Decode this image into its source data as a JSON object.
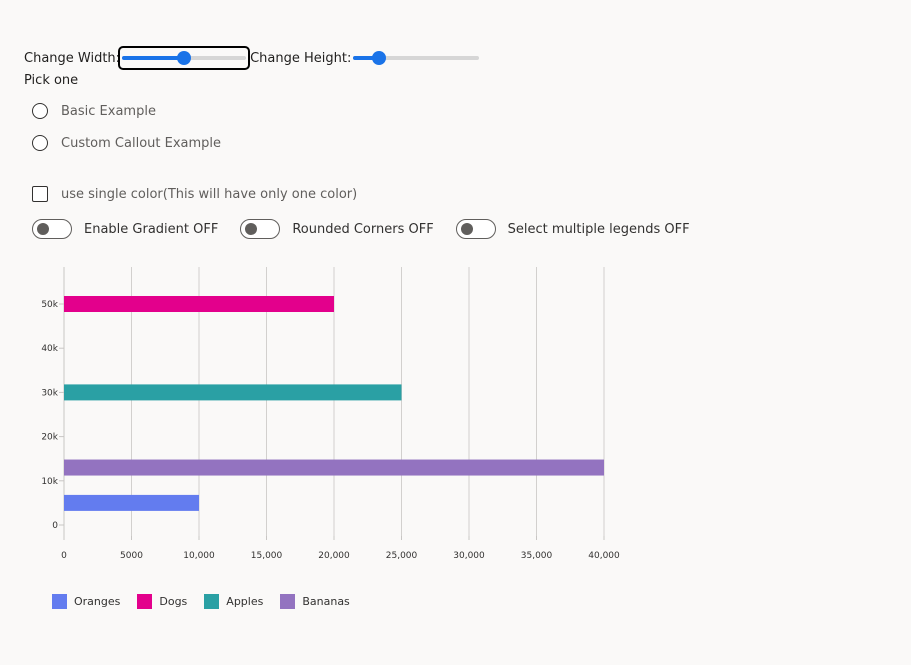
{
  "controls": {
    "width_label": "Change Width:",
    "height_label": "Change Height:",
    "width_slider_fraction": 0.5,
    "height_slider_fraction": 0.2,
    "pick_label": "Pick one",
    "radio_basic": "Basic Example",
    "radio_custom": "Custom Callout Example",
    "checkbox_label": "use single color(This will have only one color)",
    "toggle_gradient": "Enable Gradient OFF",
    "toggle_rounded": "Rounded Corners OFF",
    "toggle_legends": "Select multiple legends OFF"
  },
  "chart_data": {
    "type": "bar",
    "orientation": "horizontal",
    "x": {
      "min": 0,
      "max": 40000,
      "ticks": [
        0,
        5000,
        10000,
        15000,
        20000,
        25000,
        30000,
        35000,
        40000
      ],
      "tick_labels": [
        "0",
        "5000",
        "10,000",
        "15,000",
        "20,000",
        "25,000",
        "30,000",
        "35,000",
        "40,000"
      ]
    },
    "y": {
      "min": 0,
      "max": 50000,
      "ticks": [
        0,
        10000,
        20000,
        30000,
        40000,
        50000
      ],
      "tick_labels": [
        "0",
        "10k",
        "20k",
        "30k",
        "40k",
        "50k"
      ]
    },
    "grid": "vertical",
    "legend_position": "bottom-left",
    "series": [
      {
        "name": "Oranges",
        "y": 5000,
        "x": 10000,
        "color": "#637cef"
      },
      {
        "name": "Dogs",
        "y": 50000,
        "x": 20000,
        "color": "#e3008c"
      },
      {
        "name": "Apples",
        "y": 30000,
        "x": 25000,
        "color": "#2aa0a4"
      },
      {
        "name": "Bananas",
        "y": 13000,
        "x": 40000,
        "color": "#9373c0"
      }
    ]
  }
}
